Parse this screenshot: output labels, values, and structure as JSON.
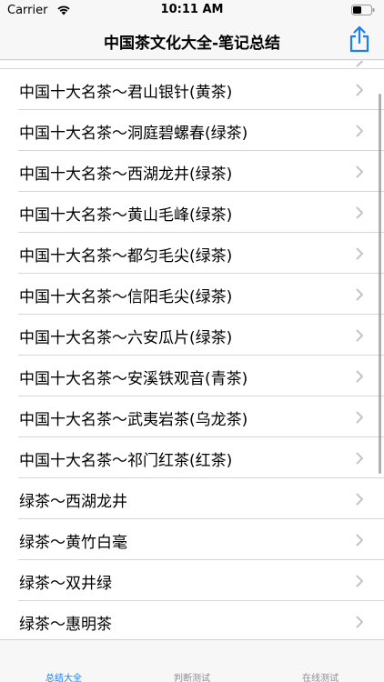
{
  "status_bar": {
    "carrier": "Carrier",
    "time": "10:11 AM"
  },
  "nav": {
    "title": "中国茶文化大全-笔记总结",
    "share_icon": "share-icon"
  },
  "list": {
    "items": [
      {
        "label": "中国十大名茶～君山银针(黄茶)"
      },
      {
        "label": "中国十大名茶～洞庭碧螺春(绿茶)"
      },
      {
        "label": "中国十大名茶～西湖龙井(绿茶)"
      },
      {
        "label": "中国十大名茶～黄山毛峰(绿茶)"
      },
      {
        "label": "中国十大名茶～都匀毛尖(绿茶)"
      },
      {
        "label": "中国十大名茶～信阳毛尖(绿茶)"
      },
      {
        "label": "中国十大名茶～六安瓜片(绿茶)"
      },
      {
        "label": "中国十大名茶～安溪铁观音(青茶)"
      },
      {
        "label": "中国十大名茶～武夷岩茶(乌龙茶)"
      },
      {
        "label": "中国十大名茶～祁门红茶(红茶)"
      },
      {
        "label": "绿茶～西湖龙井"
      },
      {
        "label": "绿茶～黄竹白毫"
      },
      {
        "label": "绿茶～双井绿"
      },
      {
        "label": "绿茶～惠明茶"
      }
    ]
  },
  "tabs": [
    {
      "label": "总结大全",
      "active": true
    },
    {
      "label": "判断测试",
      "active": false
    },
    {
      "label": "在线测试",
      "active": false
    }
  ],
  "colors": {
    "accent": "#1a7ef7",
    "inactive_tab": "#8e8e93",
    "separator": "#d6d6da",
    "chevron": "#c4c4c7"
  }
}
